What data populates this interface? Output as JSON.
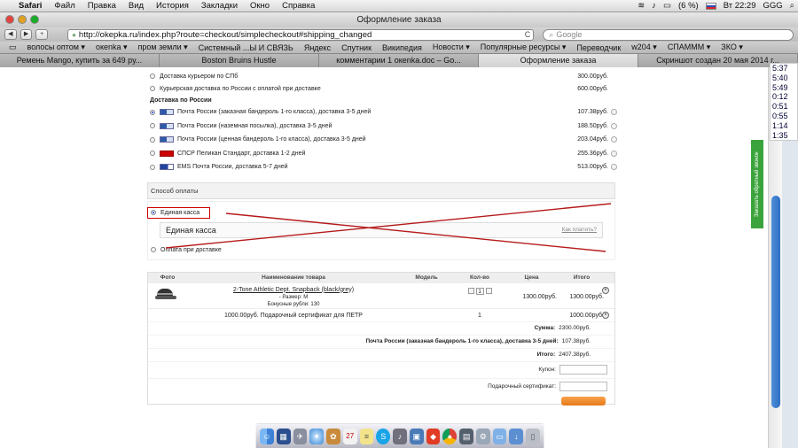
{
  "menubar": {
    "apple": "",
    "app": "Safari",
    "items": [
      "Файл",
      "Правка",
      "Вид",
      "История",
      "Закладки",
      "Окно",
      "Справка"
    ],
    "battery": "(6 %)",
    "clock": "Вт 22:29",
    "user": "GGG"
  },
  "window": {
    "title": "Оформление заказа"
  },
  "toolbar": {
    "back": "◀",
    "forward": "▶",
    "url": "http://okepka.ru/index.php?route=checkout/simplecheckout#shipping_changed",
    "refresh": "C",
    "search_placeholder": "Google"
  },
  "bookmarks": [
    "волосы оптом ▾",
    "океnka ▾",
    "пром земли ▾",
    "Системный ...Ы И СВЯЗЬ",
    "Яндекс",
    "Спутник",
    "Википедия",
    "Новости ▾",
    "Популярные ресурсы ▾",
    "Переводчик",
    "w204 ▾",
    "СПАМММ ▾",
    "ЗКО ▾"
  ],
  "tabs": [
    "Ремень Mango, купить за 649 ру...",
    "Boston Bruins Hustle",
    "комментарии 1 океnka.doc – Go...",
    "Оформление заказа",
    "Скриншот создан 20 мая 2014 г..."
  ],
  "shipping": {
    "rows_top": [
      {
        "label": "Доставка курьером по СПб",
        "price": "300.00руб."
      },
      {
        "label": "Курьерская доставка по России с оплатой при доставке",
        "price": "600.00руб."
      }
    ],
    "group_title": "Доставка по России",
    "rows": [
      {
        "label": "Почта России (заказная бандероль 1-го класса), доставка 3-5 дней",
        "price": "107.38руб.",
        "logo": "pochta",
        "selected": true
      },
      {
        "label": "Почта России (наземная посылка), доставка 3-5 дней",
        "price": "188.50руб.",
        "logo": "pochta",
        "selected": false
      },
      {
        "label": "Почта России (ценная бандероль 1-го класса), доставка 3-5 дней",
        "price": "203.04руб.",
        "logo": "pochta",
        "selected": false
      },
      {
        "label": "СПСР Пеликан Стандарт, доставка 1-2 дней",
        "price": "255.36руб.",
        "logo": "spsr",
        "selected": false
      },
      {
        "label": "EMS Почта России, доставка 5-7 дней",
        "price": "513.00руб.",
        "logo": "ems",
        "selected": false
      }
    ]
  },
  "payment": {
    "title": "Способ оплаты",
    "option1": "Единая касса",
    "box_title": "Единая касса",
    "how_to_pay": "Как платить?",
    "option2": "Оплата при доставке"
  },
  "cart": {
    "headers": {
      "foto": "Фото",
      "name": "Наименование товара",
      "model": "Модель",
      "qty": "Кол-во",
      "price": "Цена",
      "total": "Итого"
    },
    "item": {
      "name": "2-Tone Athletic Dept. Snapback (black/grey)",
      "size": "- Размер: M",
      "bonus": "Бонусные рубли: 130",
      "qty": "1",
      "price": "1300.00руб.",
      "total": "1300.00руб."
    },
    "cert": {
      "label": "1000.00руб. Подарочный сертификат для ПЕТР",
      "qty": "1",
      "total": "1000.00руб."
    },
    "sum_label": "Сумма:",
    "sum_value": "2300.00руб.",
    "ship_label": "Почта России (заказная бандероль 1-го класса), доставка 3-5 дней:",
    "ship_value": "107.38руб.",
    "total_label": "Итого:",
    "total_value": "2407.38руб.",
    "coupon_label": "Купон:",
    "cert_label": "Подарочный сертификат:"
  },
  "side": {
    "times": [
      "5:37",
      "5:40",
      "5:49",
      "0:12",
      "0:51",
      "0:55",
      "1:14",
      "1:35"
    ],
    "feedback": "Заказать обратный звонок"
  },
  "colors": {
    "accent_red": "#c00000",
    "scroll_blue": "#2d6fc2",
    "feedback_green": "#3ba33b"
  }
}
